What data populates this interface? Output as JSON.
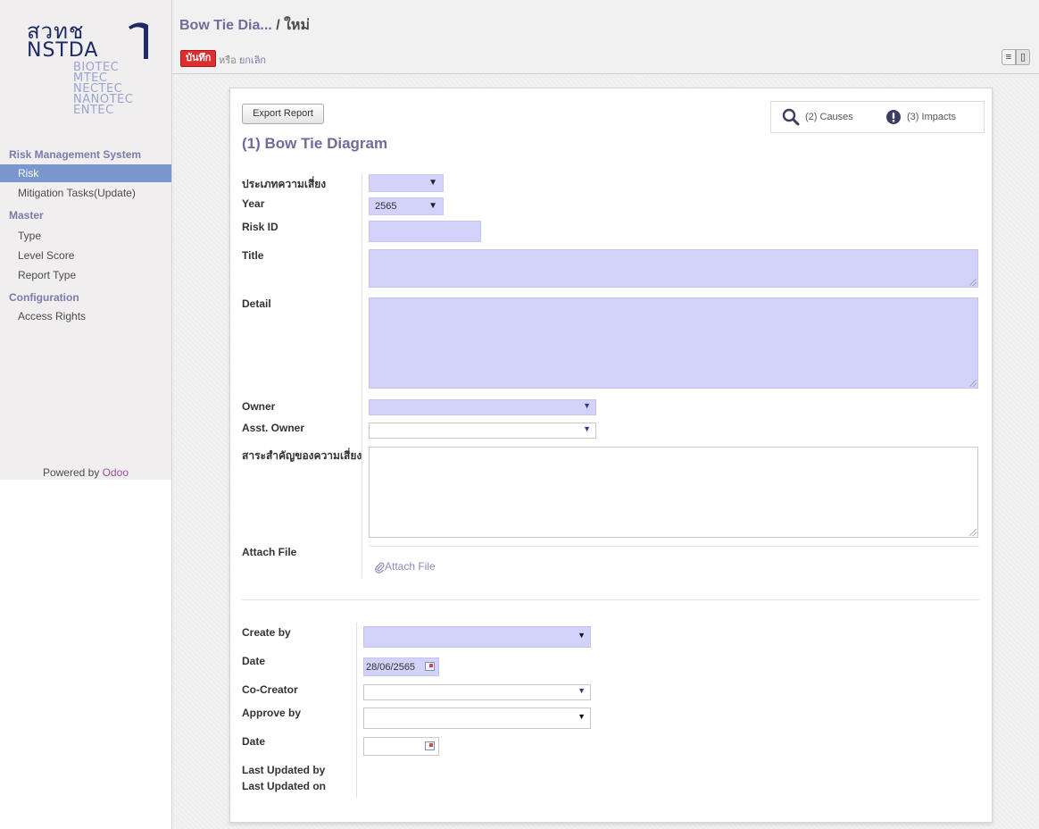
{
  "logo": {
    "mark_line1": "สวทช",
    "mark_line2": "NSTDA",
    "units": [
      "BIOTEC",
      "MTEC",
      "NECTEC",
      "NANOTEC",
      "ENTEC"
    ]
  },
  "sidebar": {
    "sections": [
      {
        "label": "Risk Management System",
        "items": [
          "Risk",
          "Mitigation Tasks(Update)"
        ]
      },
      {
        "label": "Master",
        "items": [
          "Type",
          "Level Score",
          "Report Type"
        ]
      },
      {
        "label": "Configuration",
        "items": [
          "Access Rights"
        ]
      }
    ],
    "active_item": "Risk",
    "powered_prefix": "Powered by",
    "powered_brand": "Odoo"
  },
  "header": {
    "breadcrumb_parent": "Bow Tie Dia...",
    "breadcrumb_sep": "/",
    "breadcrumb_current": "ใหม่",
    "save_label": "บันทึก",
    "or_label": "หรือ",
    "discard_label": "ยกเลิก"
  },
  "form": {
    "export_label": "Export Report",
    "causes_label": "(2) Causes",
    "impacts_label": "(3) Impacts",
    "title": "(1) Bow Tie Diagram",
    "labels": {
      "risk_type": "ประเภทความเสี่ยง",
      "year": "Year",
      "risk_id": "Risk ID",
      "title": "Title",
      "detail": "Detail",
      "owner": "Owner",
      "asst_owner": "Asst. Owner",
      "essence": "สาระสำคัญของความเสี่ยง",
      "attach_file": "Attach File",
      "create_by": "Create by",
      "date": "Date",
      "co_creator": "Co-Creator",
      "approve_by": "Approve by",
      "date2": "Date",
      "last_updated_by": "Last Updated by",
      "last_updated_on": "Last Updated on"
    },
    "values": {
      "risk_type": "",
      "year": "2565",
      "create_date": "28/06/2565"
    },
    "attach_link": "Attach File"
  },
  "colors": {
    "accent": "#7c7bad",
    "required_field": "#d2d2fa",
    "save_button": "#dc2e2e",
    "active_nav": "#7b96cc"
  }
}
